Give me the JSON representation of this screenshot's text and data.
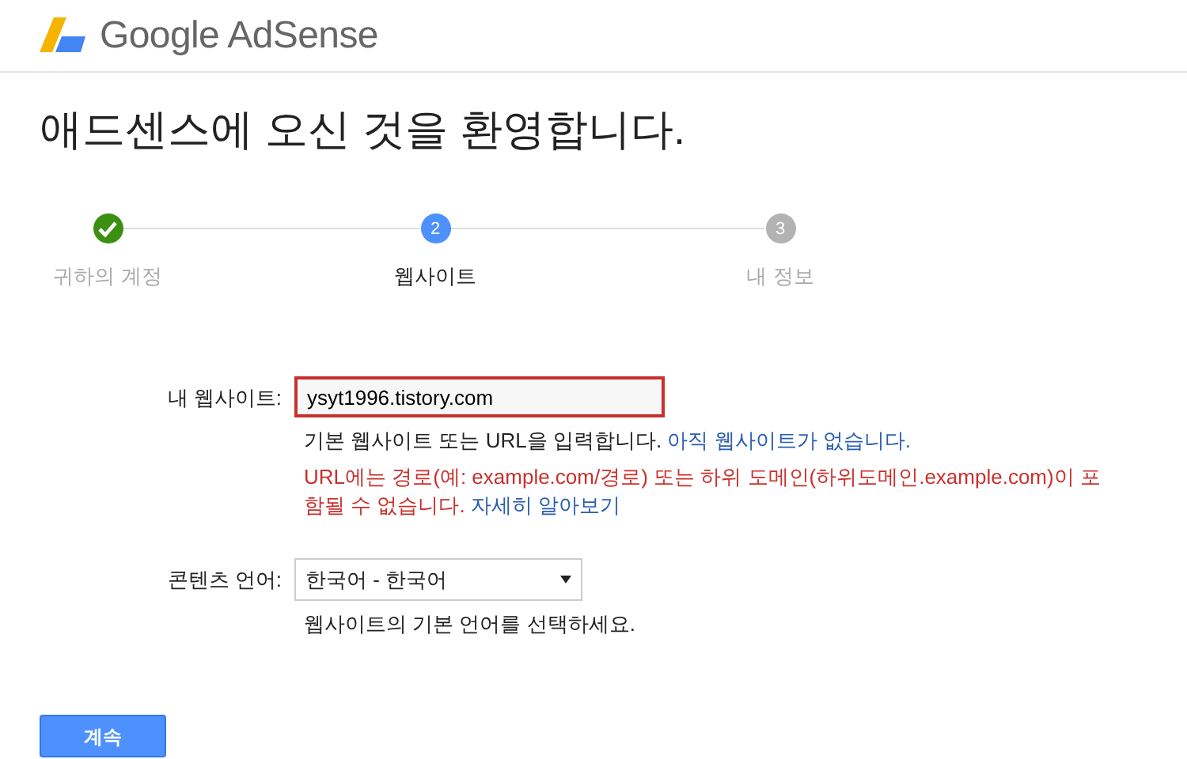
{
  "header": {
    "logo_text": "Google AdSense"
  },
  "title": "애드센스에 오신 것을 환영합니다.",
  "steps": [
    {
      "kind": "done",
      "label": "귀하의 계정",
      "selected": false
    },
    {
      "kind": "current",
      "number": "2",
      "label": "웹사이트",
      "selected": true
    },
    {
      "kind": "upcoming",
      "number": "3",
      "label": "내 정보",
      "selected": false
    }
  ],
  "website": {
    "label": "내 웹사이트:",
    "value": "ysyt1996.tistory.com",
    "invalid": true,
    "help": "기본 웹사이트 또는 URL을 입력합니다.",
    "help_link": "아직 웹사이트가 없습니다.",
    "error": "URL에는 경로(예: example.com/경로) 또는 하위 도메인(하위도메인.example.com)이 포함될 수 없습니다.",
    "error_link": "자세히 알아보기"
  },
  "language": {
    "label": "콘텐츠 언어:",
    "value": "한국어 - 한국어",
    "help": "웹사이트의 기본 언어를 선택하세요."
  },
  "button": "계속"
}
